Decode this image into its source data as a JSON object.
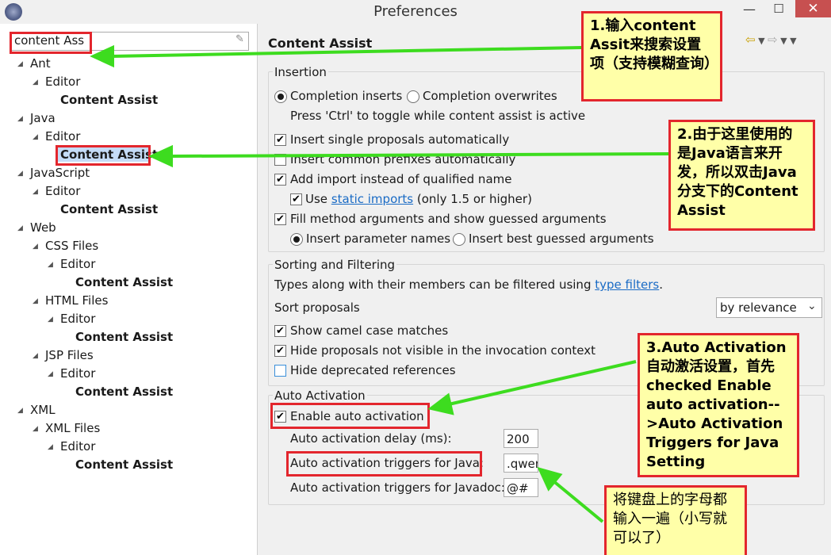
{
  "window": {
    "title": "Preferences",
    "minimize": "—",
    "maximize": "☐",
    "close": "✕"
  },
  "filter": {
    "value": "content Ass",
    "clear_icon": "eraser-icon"
  },
  "tree": [
    {
      "label": "Ant",
      "level": 1,
      "bold": false
    },
    {
      "label": "Editor",
      "level": 2,
      "bold": false
    },
    {
      "label": "Content Assist",
      "level": 3,
      "bold": true
    },
    {
      "label": "Java",
      "level": 1,
      "bold": false
    },
    {
      "label": "Editor",
      "level": 2,
      "bold": false
    },
    {
      "label": "Content Assist",
      "level": 3,
      "bold": true,
      "selected": true
    },
    {
      "label": "JavaScript",
      "level": 1,
      "bold": false
    },
    {
      "label": "Editor",
      "level": 2,
      "bold": false
    },
    {
      "label": "Content Assist",
      "level": 3,
      "bold": true
    },
    {
      "label": "Web",
      "level": 1,
      "bold": false
    },
    {
      "label": "CSS Files",
      "level": 2,
      "bold": false
    },
    {
      "label": "Editor",
      "level": 3,
      "bold": false
    },
    {
      "label": "Content Assist",
      "level": 4,
      "bold": true
    },
    {
      "label": "HTML Files",
      "level": 2,
      "bold": false
    },
    {
      "label": "Editor",
      "level": 3,
      "bold": false
    },
    {
      "label": "Content Assist",
      "level": 4,
      "bold": true
    },
    {
      "label": "JSP Files",
      "level": 2,
      "bold": false
    },
    {
      "label": "Editor",
      "level": 3,
      "bold": false
    },
    {
      "label": "Content Assist",
      "level": 4,
      "bold": true
    },
    {
      "label": "XML",
      "level": 1,
      "bold": false
    },
    {
      "label": "XML Files",
      "level": 2,
      "bold": false
    },
    {
      "label": "Editor",
      "level": 3,
      "bold": false
    },
    {
      "label": "Content Assist",
      "level": 4,
      "bold": true
    }
  ],
  "page": {
    "title": "Content Assist",
    "nav": [
      "back-arrow-icon",
      "dropdown-icon",
      "forward-arrow-icon",
      "dropdown-icon",
      "view-menu-icon"
    ]
  },
  "insertion": {
    "title": "Insertion",
    "completion_inserts": "Completion inserts",
    "completion_overwrites": "Completion overwrites",
    "toggle_hint": "Press 'Ctrl' to toggle while content assist is active",
    "insert_single": "Insert single proposals automatically",
    "insert_prefixes": "Insert common prefixes automatically",
    "add_import": "Add import instead of qualified name",
    "use_word": "Use",
    "static_imports": "static imports",
    "only_15": "(only 1.5 or higher)",
    "fill_args": "Fill method arguments and show guessed arguments",
    "insert_param_names": "Insert parameter names",
    "insert_best_guessed": "Insert best guessed arguments"
  },
  "sorting": {
    "title": "Sorting and Filtering",
    "types_text": "Types along with their members can be filtered using",
    "type_filters": "type filters",
    "period": ".",
    "sort_proposals": "Sort proposals",
    "sort_value": "by relevance",
    "camel_case": "Show camel case matches",
    "hide_not_visible": "Hide proposals not visible in the invocation context",
    "hide_deprecated": "Hide deprecated references"
  },
  "auto_activation": {
    "title": "Auto Activation",
    "enable": "Enable auto activation",
    "delay_label": "Auto activation delay (ms):",
    "delay_value": "200",
    "java_label": "Auto activation triggers for Java:",
    "java_value": ".qwer",
    "javadoc_label": "Auto activation triggers for Javadoc:",
    "javadoc_value": "@#"
  },
  "notes": {
    "n1": "1.输入content Assit来搜索设置项（支持模糊查询）",
    "n2": "2.由于这里使用的是Java语言来开发，所以双击Java分支下的Content Assist",
    "n3": "3.Auto Activation 自动激活设置，首先checked Enable auto activation-->Auto Activation Triggers for Java Setting",
    "n4": "将键盘上的字母都输入一遍（小写就可以了）"
  },
  "colors": {
    "annotation_border": "#e3262d",
    "note_bg": "#ffffa8",
    "arrow": "#3ddc1f",
    "link": "#1a6bc5",
    "selection": "#c5dcf7"
  }
}
